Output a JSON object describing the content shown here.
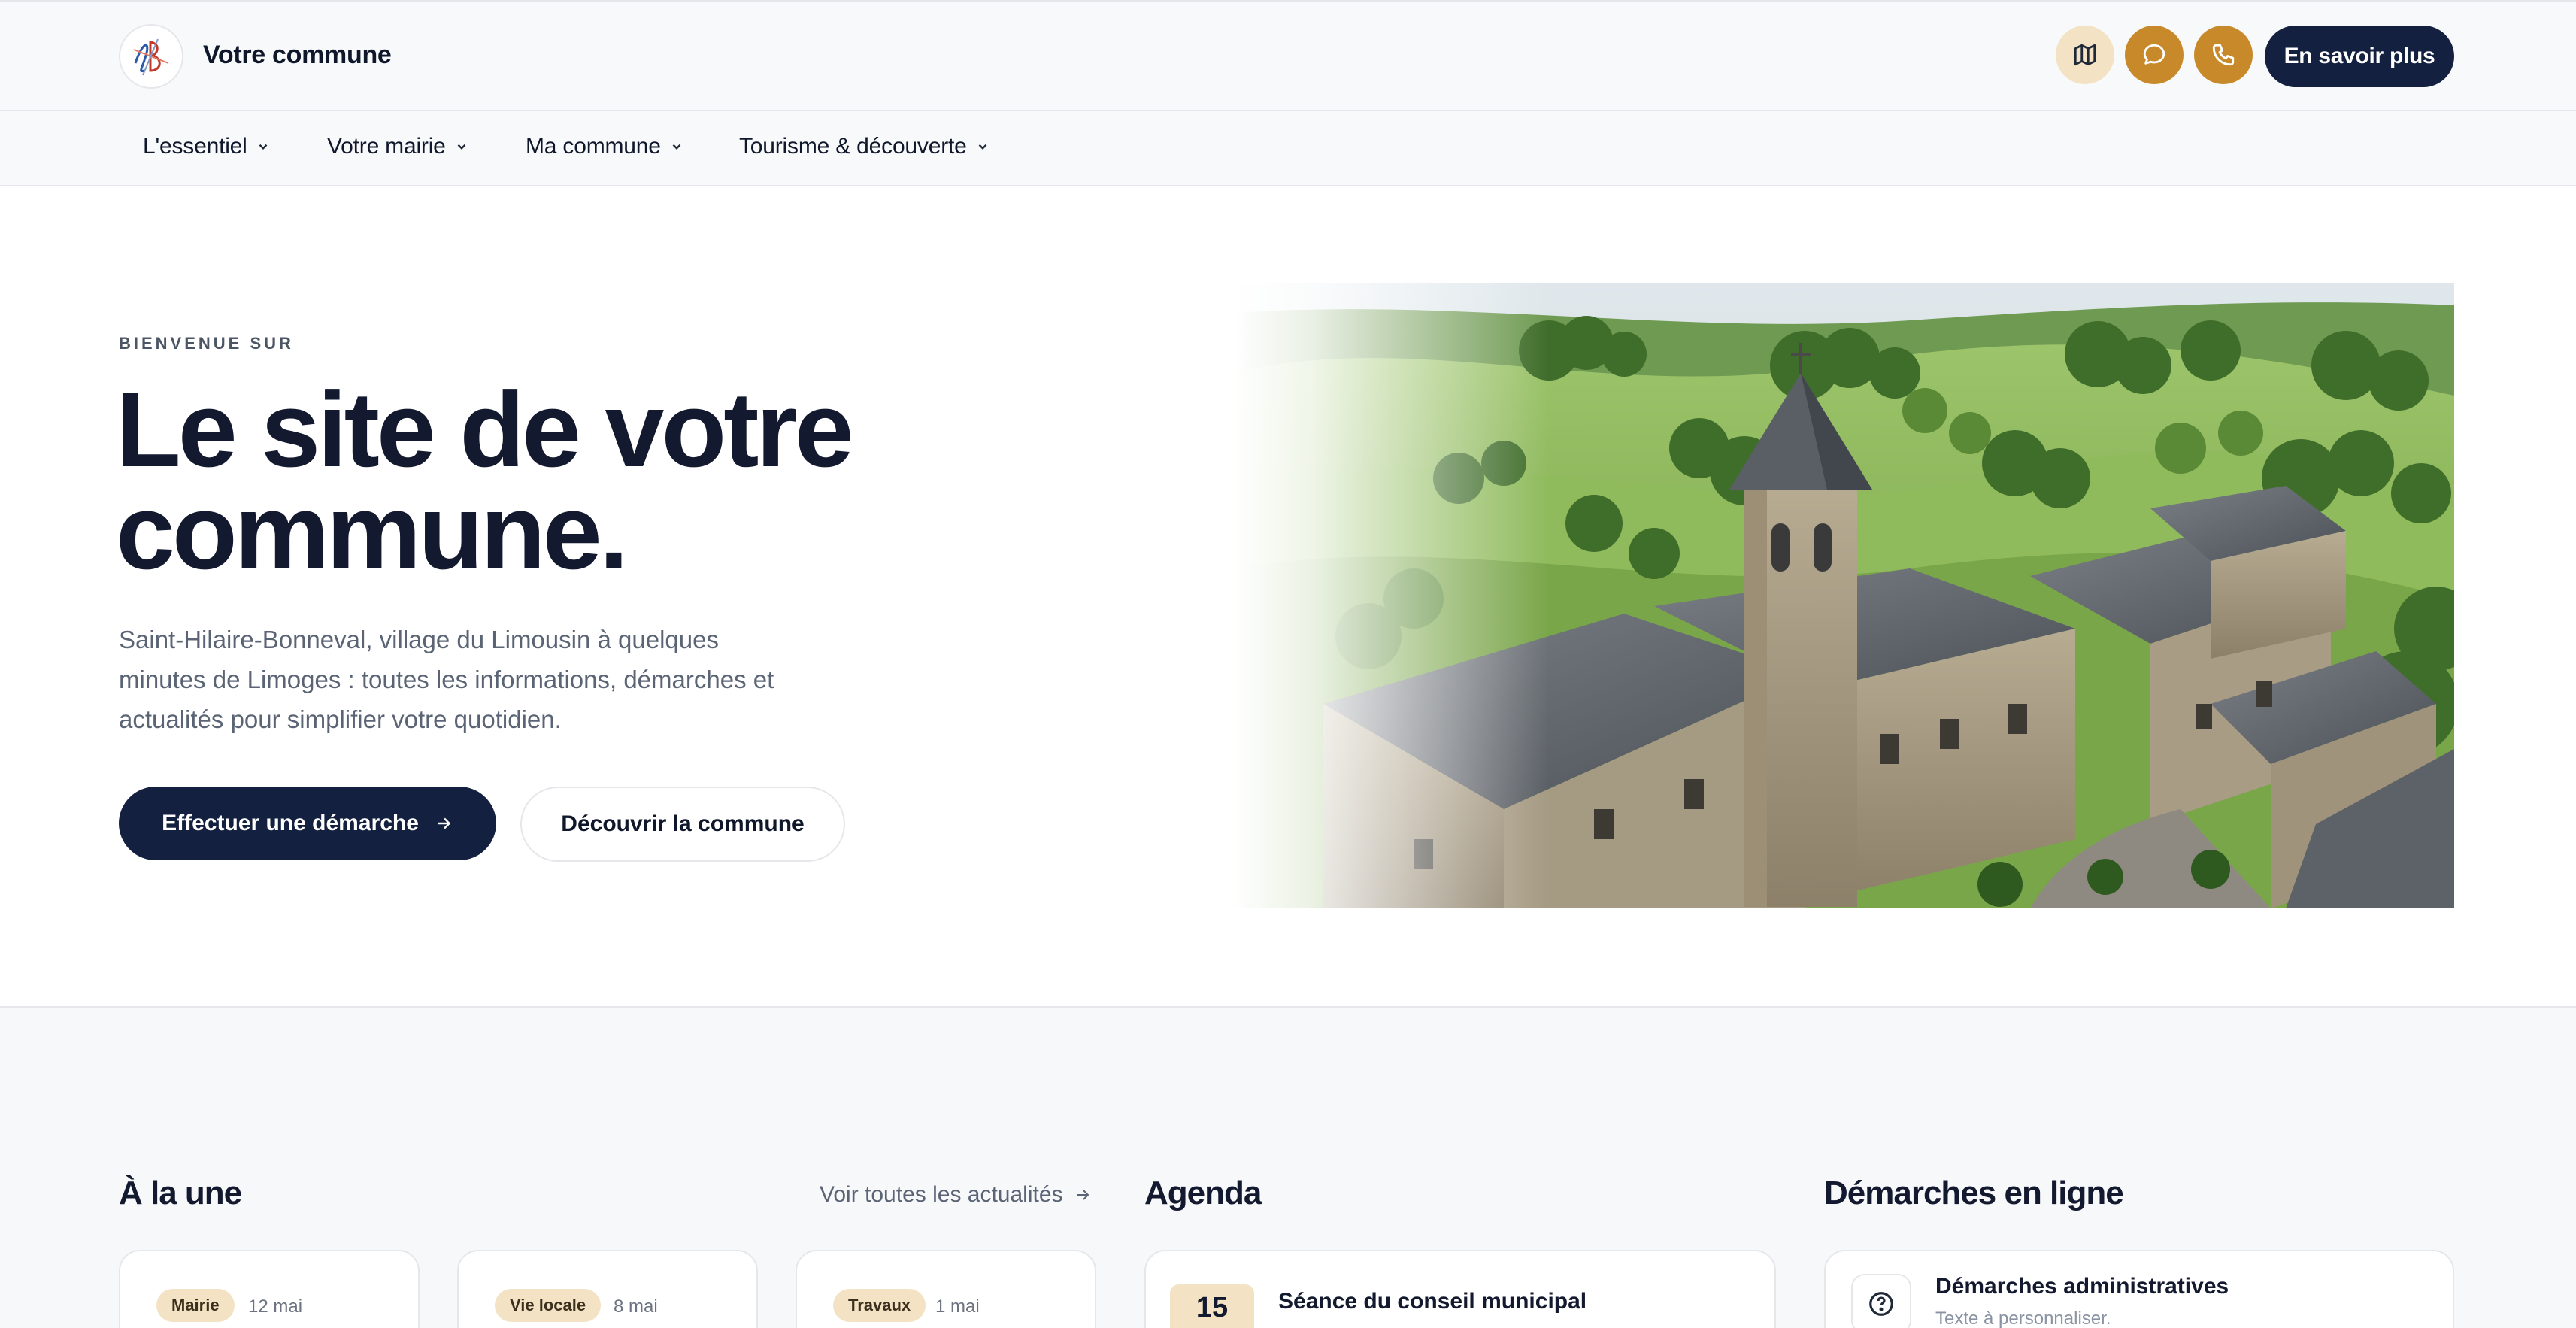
{
  "header": {
    "site_name": "Votre commune",
    "logo_text": "SB",
    "cta_label": "En savoir plus",
    "icons": [
      "map-icon",
      "chat-icon",
      "phone-icon"
    ]
  },
  "nav": {
    "items": [
      {
        "label": "L'essentiel"
      },
      {
        "label": "Votre mairie"
      },
      {
        "label": "Ma commune"
      },
      {
        "label": "Tourisme & découverte"
      }
    ]
  },
  "hero": {
    "eyebrow": "BIENVENUE SUR",
    "title_line1": "Le site de votre",
    "title_line2": "commune.",
    "description": "Saint-Hilaire-Bonneval, village du Limousin à quelques minutes de Limoges : toutes les informations, démarches et actualités pour simplifier votre quotidien.",
    "primary_button": "Effectuer une démarche",
    "secondary_button": "Découvrir la commune"
  },
  "news": {
    "title": "À la une",
    "see_all": "Voir toutes les actualités",
    "cards": [
      {
        "tag": "Mairie",
        "date": "12 mai"
      },
      {
        "tag": "Vie locale",
        "date": "8 mai"
      },
      {
        "tag": "Travaux",
        "date": "1 mai"
      }
    ]
  },
  "agenda": {
    "title": "Agenda",
    "events": [
      {
        "day": "15",
        "title": "Séance du conseil municipal"
      }
    ]
  },
  "demarches": {
    "title": "Démarches en ligne",
    "items": [
      {
        "title": "Démarches administratives",
        "subtitle": "Texte à personnaliser."
      }
    ]
  },
  "colors": {
    "navy": "#13203f",
    "gold": "#c8892b",
    "sand": "#f3e3c4",
    "background_light": "#f8f9fb"
  }
}
